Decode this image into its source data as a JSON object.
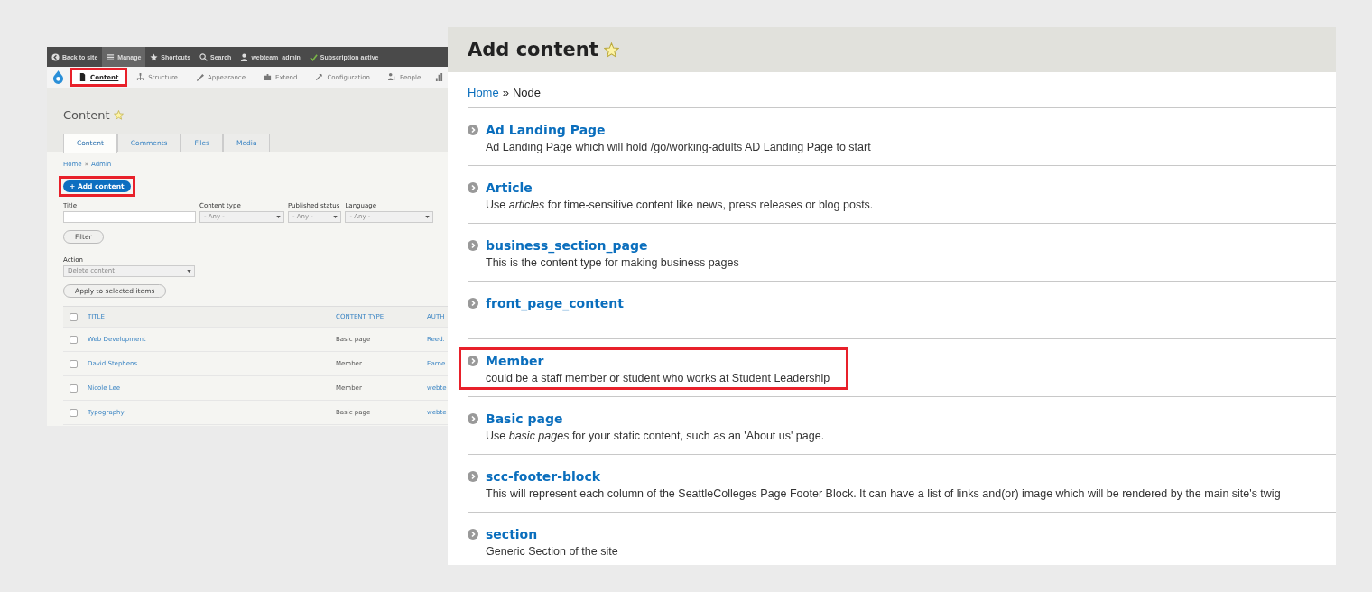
{
  "admin_screen": {
    "toolbar": [
      {
        "label": "Back to site",
        "selected": false
      },
      {
        "label": "Manage",
        "selected": true
      },
      {
        "label": "Shortcuts",
        "selected": false
      },
      {
        "label": "Search",
        "selected": false
      },
      {
        "label": "webteam_admin",
        "selected": false
      },
      {
        "label": "Subscription active",
        "selected": false
      }
    ],
    "nav": [
      {
        "label": "Content",
        "selected": true,
        "highlighted": true
      },
      {
        "label": "Structure",
        "selected": false,
        "highlighted": false
      },
      {
        "label": "Appearance",
        "selected": false,
        "highlighted": false
      },
      {
        "label": "Extend",
        "selected": false,
        "highlighted": false
      },
      {
        "label": "Configuration",
        "selected": false,
        "highlighted": false
      },
      {
        "label": "People",
        "selected": false,
        "highlighted": false
      }
    ],
    "title": "Content",
    "tabs": [
      {
        "label": "Content",
        "selected": true
      },
      {
        "label": "Comments",
        "selected": false
      },
      {
        "label": "Files",
        "selected": false
      },
      {
        "label": "Media",
        "selected": false
      }
    ],
    "breadcrumb": {
      "links": [
        "Home",
        "Admin"
      ],
      "separator": "»"
    },
    "add_button": {
      "label": "+ Add content",
      "highlighted": true
    },
    "filters": [
      {
        "label": "Title",
        "kind": "text"
      },
      {
        "label": "Content type",
        "kind": "select",
        "value": "- Any -"
      },
      {
        "label": "Published status",
        "kind": "select",
        "value": "- Any -"
      },
      {
        "label": "Language",
        "kind": "select",
        "value": "- Any -"
      }
    ],
    "filter_button": "Filter",
    "action": {
      "label": "Action",
      "value": "Delete content"
    },
    "apply_button": "Apply to selected items",
    "table": {
      "select_all_checked": false,
      "columns": [
        "TITLE",
        "CONTENT TYPE",
        "AUTH"
      ],
      "rows": [
        {
          "checked": false,
          "cells": [
            "Web Development",
            "Basic page",
            "Reed."
          ]
        },
        {
          "checked": false,
          "cells": [
            "David Stephens",
            "Member",
            "Earne"
          ]
        },
        {
          "checked": false,
          "cells": [
            "Nicole Lee",
            "Member",
            "webte"
          ]
        },
        {
          "checked": false,
          "cells": [
            "Typography",
            "Basic page",
            "webte"
          ]
        }
      ]
    }
  },
  "add_content_screen": {
    "title": "Add content",
    "breadcrumb": {
      "link": "Home",
      "separator": "»",
      "current": "Node"
    },
    "types": [
      {
        "name": "Ad Landing Page",
        "description": "Ad Landing Page which will hold /go/working-adults AD Landing Page to start",
        "highlighted": false
      },
      {
        "name": "Article",
        "description": "Use *articles* for time-sensitive content like news, press releases or blog posts.",
        "highlighted": false
      },
      {
        "name": "business_section_page",
        "description": "This is the content type for making business pages",
        "highlighted": false
      },
      {
        "name": "front_page_content",
        "highlighted": false
      },
      {
        "name": "Member",
        "description": "could be a staff member or student who works at Student Leadership",
        "highlighted": true
      },
      {
        "name": "Basic page",
        "description": "Use *basic pages* for your static content, such as an 'About us' page.",
        "highlighted": false
      },
      {
        "name": "scc-footer-block",
        "description": "This will represent each column of the SeattleColleges Page Footer Block. It can have a list of links and(or) image which will be rendered by the main site's twig",
        "highlighted": false
      },
      {
        "name": "section",
        "description": "Generic Section of the site",
        "highlighted": false
      }
    ]
  }
}
